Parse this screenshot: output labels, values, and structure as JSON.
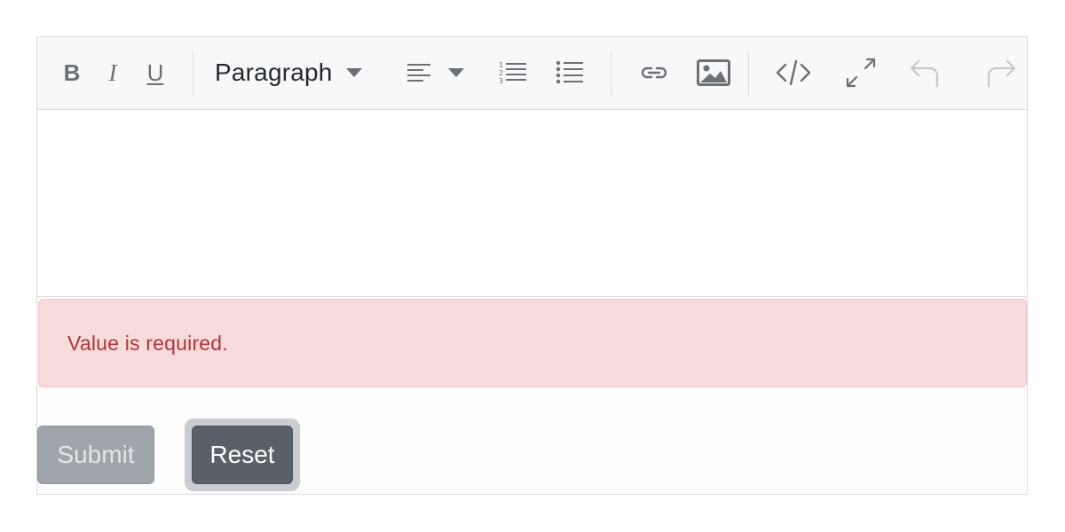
{
  "toolbar": {
    "bold_label": "B",
    "italic_label": "I",
    "underline_label": "U",
    "block_format_label": "Paragraph",
    "icons": {
      "bold": "bold-icon",
      "italic": "italic-icon",
      "underline": "underline-icon",
      "paragraph_dropdown": "chevron-down-icon",
      "align": "align-left-icon",
      "align_dropdown": "chevron-down-icon",
      "ordered_list": "ordered-list-icon",
      "bullet_list": "bullet-list-icon",
      "link": "link-icon",
      "image": "image-icon",
      "code": "code-icon",
      "fullscreen": "expand-icon",
      "undo": "undo-icon",
      "redo": "redo-icon"
    }
  },
  "editor": {
    "content": ""
  },
  "validation": {
    "message": "Value is required."
  },
  "actions": {
    "submit_label": "Submit",
    "reset_label": "Reset"
  },
  "colors": {
    "toolbar_bg": "#f7f8f9",
    "icon": "#6b7075",
    "icon_disabled": "#c4c8cc",
    "error_bg": "#f7dbdc",
    "error_text": "#b1353a",
    "submit_bg": "#9fa5ab",
    "reset_bg": "#596068"
  }
}
